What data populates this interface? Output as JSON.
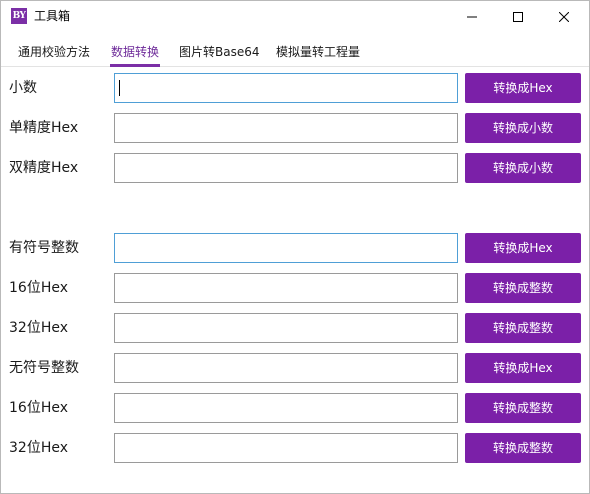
{
  "window": {
    "title": "工具箱",
    "logo_text": "BY",
    "accent_color": "#7b20a8"
  },
  "window_controls": {
    "minimize_icon": "minimize-icon",
    "maximize_icon": "maximize-icon",
    "close_icon": "close-icon"
  },
  "tabs": [
    {
      "label": "通用校验方法",
      "active": false
    },
    {
      "label": "数据转换",
      "active": true
    },
    {
      "label": "图片转Base64",
      "active": false
    },
    {
      "label": "模拟量转工程量",
      "active": false
    }
  ],
  "rows": [
    {
      "label": "小数",
      "value": "",
      "button": "转换成Hex",
      "focused": true
    },
    {
      "label": "单精度Hex",
      "value": "",
      "button": "转换成小数",
      "focused": false
    },
    {
      "label": "双精度Hex",
      "value": "",
      "button": "转换成小数",
      "focused": false
    },
    {
      "label": "有符号整数",
      "value": "",
      "button": "转换成Hex",
      "focused": false
    },
    {
      "label": "16位Hex",
      "value": "",
      "button": "转换成整数",
      "focused": false
    },
    {
      "label": "32位Hex",
      "value": "",
      "button": "转换成整数",
      "focused": false
    },
    {
      "label": "无符号整数",
      "value": "",
      "button": "转换成Hex",
      "focused": false
    },
    {
      "label": "16位Hex",
      "value": "",
      "button": "转换成整数",
      "focused": false
    },
    {
      "label": "32位Hex",
      "value": "",
      "button": "转换成整数",
      "focused": false
    }
  ]
}
